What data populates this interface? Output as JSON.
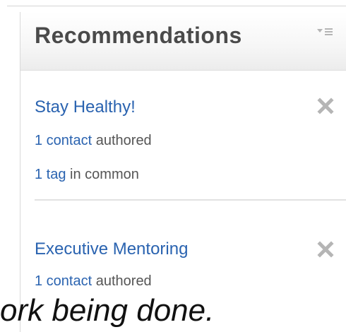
{
  "widget": {
    "title": "Recommendations",
    "menu_icon": "sort-menu-icon"
  },
  "recommendations": [
    {
      "title": "Stay Healthy!",
      "lines": [
        {
          "link": "1 contact",
          "rest": " authored"
        },
        {
          "link": "1 tag",
          "rest": " in common"
        }
      ],
      "dismiss_icon": "close-x-icon"
    },
    {
      "title": "Executive Mentoring",
      "lines": [
        {
          "link": "1 contact",
          "rest": " authored"
        }
      ],
      "dismiss_icon": "close-x-icon"
    }
  ],
  "overlay": {
    "caption": "ork being done."
  },
  "colors": {
    "link": "#2a63b0",
    "title_text": "#4a4a4a",
    "body_text": "#555555",
    "icon_gray": "#b5b5b5"
  }
}
